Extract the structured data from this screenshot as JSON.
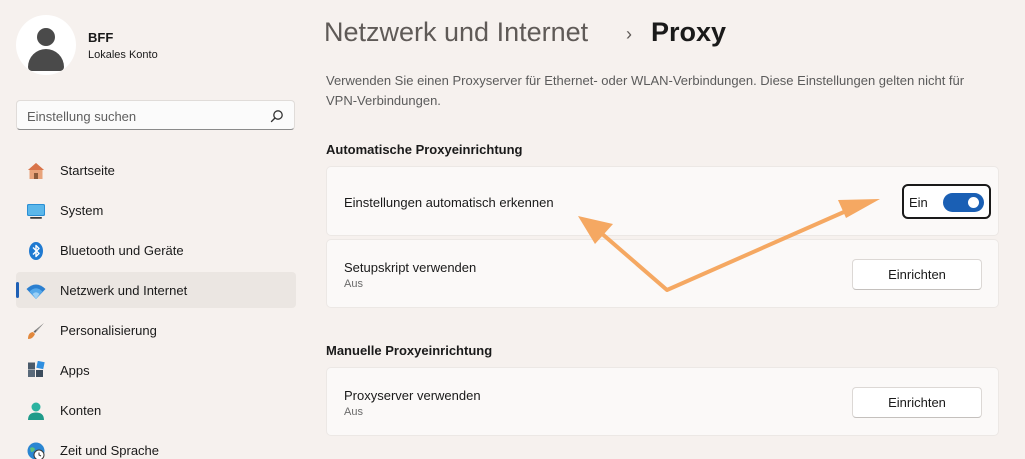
{
  "user": {
    "name": "BFF",
    "account_type": "Lokales Konto"
  },
  "search": {
    "placeholder": "Einstellung suchen"
  },
  "nav": {
    "items": [
      {
        "label": "Startseite",
        "icon": "home-icon",
        "active": false
      },
      {
        "label": "System",
        "icon": "monitor-icon",
        "active": false
      },
      {
        "label": "Bluetooth und Geräte",
        "icon": "bluetooth-icon",
        "active": false
      },
      {
        "label": "Netzwerk und Internet",
        "icon": "wifi-icon",
        "active": true
      },
      {
        "label": "Personalisierung",
        "icon": "brush-icon",
        "active": false
      },
      {
        "label": "Apps",
        "icon": "apps-icon",
        "active": false
      },
      {
        "label": "Konten",
        "icon": "person-icon",
        "active": false
      },
      {
        "label": "Zeit und Sprache",
        "icon": "globe-clock-icon",
        "active": false
      }
    ]
  },
  "header": {
    "parent": "Netzwerk und Internet",
    "separator": "›",
    "current": "Proxy"
  },
  "description": "Verwenden Sie einen Proxyserver für Ethernet- oder WLAN-Verbindungen. Diese Einstellungen gelten nicht für VPN-Verbindungen.",
  "auto_section": {
    "title": "Automatische Proxyeinrichtung",
    "detect": {
      "label": "Einstellungen automatisch erkennen",
      "state_label": "Ein",
      "on": true
    },
    "script": {
      "label": "Setupskript verwenden",
      "status": "Aus",
      "button": "Einrichten"
    }
  },
  "manual_section": {
    "title": "Manuelle Proxyeinrichtung",
    "proxy": {
      "label": "Proxyserver verwenden",
      "status": "Aus",
      "button": "Einrichten"
    }
  },
  "colors": {
    "accent": "#1a5fb4",
    "annotation_arrow": "#f5a862",
    "background": "#f6f1ee"
  }
}
